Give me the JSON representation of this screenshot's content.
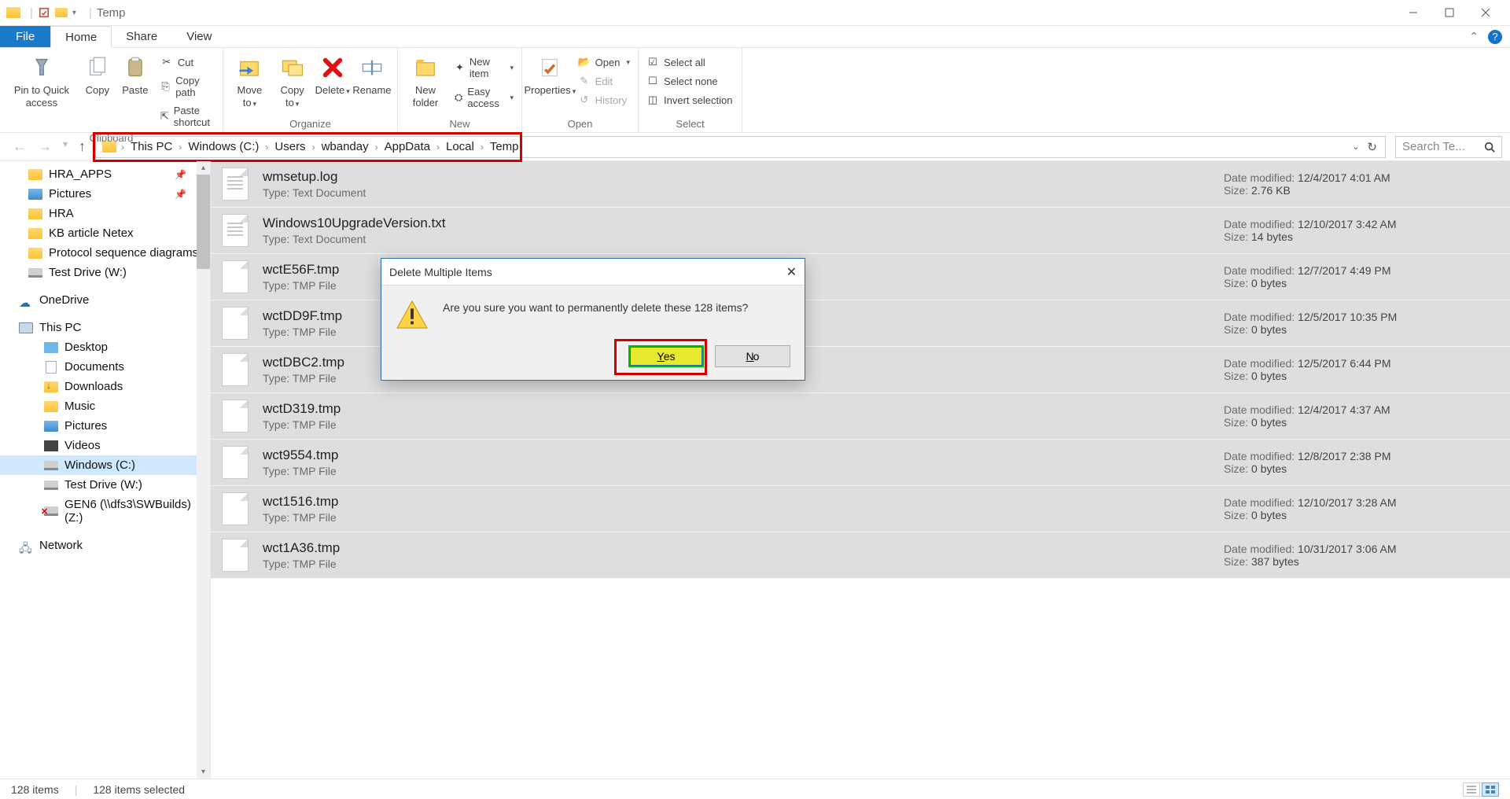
{
  "window": {
    "title": "Temp",
    "min_tooltip": "Minimize",
    "max_tooltip": "Maximize",
    "close_tooltip": "Close"
  },
  "tabs": {
    "file": "File",
    "home": "Home",
    "share": "Share",
    "view": "View"
  },
  "ribbon": {
    "clipboard": {
      "label": "Clipboard",
      "pin": "Pin to Quick access",
      "copy": "Copy",
      "paste": "Paste",
      "cut": "Cut",
      "copy_path": "Copy path",
      "paste_shortcut": "Paste shortcut"
    },
    "organize": {
      "label": "Organize",
      "move_to": "Move to",
      "copy_to": "Copy to",
      "delete": "Delete",
      "rename": "Rename"
    },
    "new": {
      "label": "New",
      "new_folder": "New folder",
      "new_item": "New item",
      "easy_access": "Easy access"
    },
    "open": {
      "label": "Open",
      "properties": "Properties",
      "open": "Open",
      "edit": "Edit",
      "history": "History"
    },
    "select": {
      "label": "Select",
      "select_all": "Select all",
      "select_none": "Select none",
      "invert": "Invert selection"
    }
  },
  "breadcrumb": [
    "This PC",
    "Windows (C:)",
    "Users",
    "wbanday",
    "AppData",
    "Local",
    "Temp"
  ],
  "search_placeholder": "Search Te...",
  "tree": {
    "items": [
      {
        "label": "HRA_APPS",
        "icon": "folder",
        "lvl": 0,
        "pin": true
      },
      {
        "label": "Pictures",
        "icon": "pictures",
        "lvl": 0,
        "pin": true
      },
      {
        "label": "HRA",
        "icon": "folder",
        "lvl": 0
      },
      {
        "label": "KB article Netex",
        "icon": "folder",
        "lvl": 0
      },
      {
        "label": "Protocol sequence diagrams",
        "icon": "folder",
        "lvl": 0
      },
      {
        "label": "Test Drive (W:)",
        "icon": "drive",
        "lvl": 0
      },
      {
        "label": "",
        "icon": "spacer",
        "lvl": 0
      },
      {
        "label": "OneDrive",
        "icon": "onedrive",
        "lvl": -1
      },
      {
        "label": "",
        "icon": "spacer",
        "lvl": 0
      },
      {
        "label": "This PC",
        "icon": "pc",
        "lvl": -1
      },
      {
        "label": "Desktop",
        "icon": "desktop",
        "lvl": 1
      },
      {
        "label": "Documents",
        "icon": "documents",
        "lvl": 1
      },
      {
        "label": "Downloads",
        "icon": "downloads",
        "lvl": 1
      },
      {
        "label": "Music",
        "icon": "music",
        "lvl": 1
      },
      {
        "label": "Pictures",
        "icon": "pictures",
        "lvl": 1
      },
      {
        "label": "Videos",
        "icon": "videos",
        "lvl": 1
      },
      {
        "label": "Windows (C:)",
        "icon": "drive",
        "lvl": 1,
        "selected": true
      },
      {
        "label": "Test Drive (W:)",
        "icon": "drive",
        "lvl": 1
      },
      {
        "label": "GEN6 (\\\\dfs3\\SWBuilds) (Z:)",
        "icon": "drive-err",
        "lvl": 1
      },
      {
        "label": "",
        "icon": "spacer",
        "lvl": 0
      },
      {
        "label": "Network",
        "icon": "network",
        "lvl": -1
      }
    ]
  },
  "file_labels": {
    "type": "Type:",
    "modified": "Date modified:",
    "size": "Size:"
  },
  "files": [
    {
      "name": "wmsetup.log",
      "type": "Text Document",
      "modified": "12/4/2017 4:01 AM",
      "size": "2.76 KB",
      "icon": "txt"
    },
    {
      "name": "Windows10UpgradeVersion.txt",
      "type": "Text Document",
      "modified": "12/10/2017 3:42 AM",
      "size": "14 bytes",
      "icon": "txt"
    },
    {
      "name": "wctE56F.tmp",
      "type": "TMP File",
      "modified": "12/7/2017 4:49 PM",
      "size": "0 bytes",
      "icon": "blank"
    },
    {
      "name": "wctDD9F.tmp",
      "type": "TMP File",
      "modified": "12/5/2017 10:35 PM",
      "size": "0 bytes",
      "icon": "blank"
    },
    {
      "name": "wctDBC2.tmp",
      "type": "TMP File",
      "modified": "12/5/2017 6:44 PM",
      "size": "0 bytes",
      "icon": "blank"
    },
    {
      "name": "wctD319.tmp",
      "type": "TMP File",
      "modified": "12/4/2017 4:37 AM",
      "size": "0 bytes",
      "icon": "blank"
    },
    {
      "name": "wct9554.tmp",
      "type": "TMP File",
      "modified": "12/8/2017 2:38 PM",
      "size": "0 bytes",
      "icon": "blank"
    },
    {
      "name": "wct1516.tmp",
      "type": "TMP File",
      "modified": "12/10/2017 3:28 AM",
      "size": "0 bytes",
      "icon": "blank"
    },
    {
      "name": "wct1A36.tmp",
      "type": "TMP File",
      "modified": "10/31/2017 3:06 AM",
      "size": "387 bytes",
      "icon": "blank"
    }
  ],
  "dialog": {
    "title": "Delete Multiple Items",
    "message": "Are you sure you want to permanently delete these 128 items?",
    "yes": "Yes",
    "no": "No"
  },
  "status": {
    "count": "128 items",
    "selected": "128 items selected"
  }
}
